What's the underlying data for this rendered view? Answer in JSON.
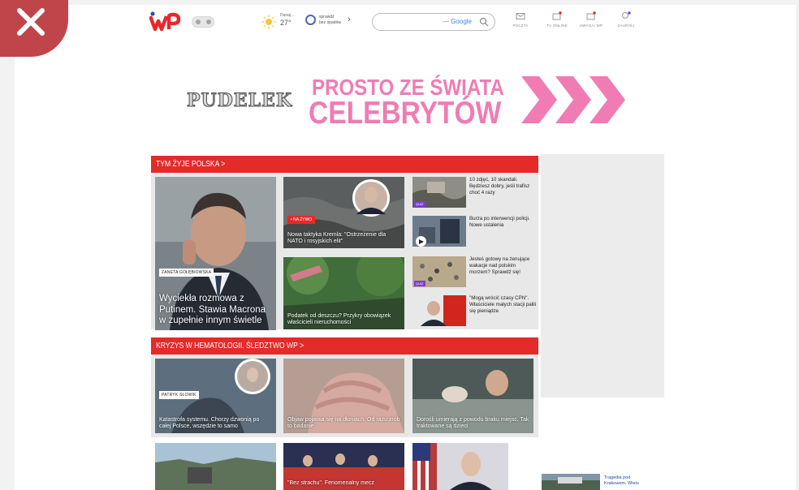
{
  "header": {
    "weather": {
      "label": "Dunaj...",
      "temp": "27°"
    },
    "air": {
      "line1": "sprawdź",
      "line2": "bez opadów"
    },
    "search": {
      "provider": "Google"
    },
    "nav": [
      {
        "label": "POCZTA",
        "icon": "mail-icon",
        "dot": false
      },
      {
        "label": "TV ONLINE",
        "icon": "tv-icon",
        "dot": true
      },
      {
        "label": "UWAGA! WP",
        "icon": "alert-icon",
        "dot": true
      },
      {
        "label": "ZAUROLI",
        "icon": "user-icon",
        "dot": true
      }
    ]
  },
  "banner": {
    "brand": "PUDELEK",
    "line1": "PROSTO ZE ŚWIATA",
    "line2": "CELEBRYTÓW"
  },
  "sections": [
    {
      "title": "TYM ŻYJE POLSKA >",
      "hero": {
        "tag": "ŻANETA GOŁĘBIOWSKA",
        "title": "Wyciekła rozmowa z Putinem. Stawia Macrona w zupełnie innym świetle"
      },
      "mid": [
        {
          "badge": "• NA ŻYWO",
          "title": "Nowa taktyka Kremla: \"Ostrzeżenie dla NATO i rosyjskich elit\""
        },
        {
          "title": "Podatek od deszczu? Przykry obowiązek właścicieli nieruchomości"
        }
      ],
      "small": [
        {
          "badge": "QUIZ",
          "text": "10 zdjęć, 10 skandali. Będziesz dobry, jeśli trafisz choć 4 razy"
        },
        {
          "badge": "",
          "text": "Burza po interwencji policji. Nowe ustalenia"
        },
        {
          "badge": "QUIZ",
          "text": "Jesteś gotowy na żenujące wakacje nad polskim morzem? Sprawdź się!"
        },
        {
          "badge": "",
          "text": "\"Mogą wrócić czasy CPN\". Właściciele małych stacji palili się pieniądze"
        }
      ]
    },
    {
      "title": "KRYZYS W HEMATOLOGII. ŚLEDZTWO WP >",
      "tiles": [
        {
          "tag": "PATRYK SŁOWIK",
          "title": "Katastrofa systemu. Chorzy dzwonią po całej Polsce, wszędzie to samo"
        },
        {
          "tag": "",
          "title": "Objaw pojawia się na dłoniach. Od razu zrób to badanie"
        },
        {
          "tag": "",
          "title": "Dorośli umierają z powodu braku miejsc. Tak traktowane są dzieci"
        }
      ]
    }
  ],
  "row3": [
    {
      "title": ""
    },
    {
      "title": "\"Bez strachu\". Fenomenalny mecz"
    },
    {
      "title": ""
    }
  ],
  "sidebar_story": {
    "text": "Tragedia pod Krakowem. Wielu"
  },
  "colors": {
    "red": "#e52a2a",
    "pink": "#f07cb3",
    "close_badge": "#c0454a"
  }
}
